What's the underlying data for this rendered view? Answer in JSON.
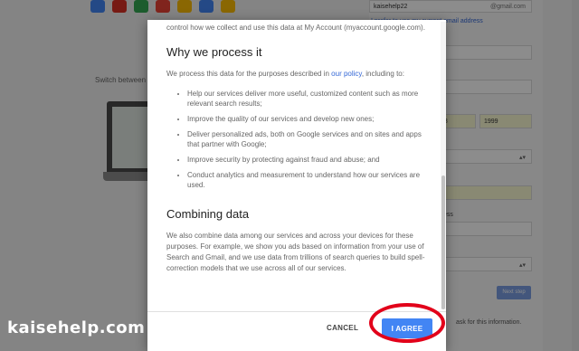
{
  "background": {
    "app_icons": [
      {
        "icon": "google-icon",
        "color": "#4285f4"
      },
      {
        "icon": "gmail-icon",
        "color": "#d93025"
      },
      {
        "icon": "maps-icon",
        "color": "#34a853"
      },
      {
        "icon": "youtube-icon",
        "color": "#ea4335"
      },
      {
        "icon": "drive-icon",
        "color": "#fbbc05"
      },
      {
        "icon": "play-icon",
        "color": "#4285f4"
      },
      {
        "icon": "chrome-icon",
        "color": "#fbbc05"
      }
    ],
    "switch_text": "Switch between",
    "form": {
      "username_value": "kaisehelp22",
      "username_domain": "@gmail.com",
      "link_text": "I prefer to use my current email address",
      "day_value": "18",
      "year_value": "1999",
      "section_label": "ess",
      "country_value": "m",
      "next_label": "Next step",
      "footer_text": "ask for this information."
    }
  },
  "watermark": "kaisehelp.com",
  "dialog": {
    "intro_text": "control how we collect and use this data at My Account (myaccount.google.com).",
    "section1_heading": "Why we process it",
    "section1_text_before": "We process this data for the purposes described in ",
    "section1_link": "our policy",
    "section1_text_after": ", including to:",
    "bullets": [
      "Help our services deliver more useful, customized content such as more relevant search results;",
      "Improve the quality of our services and develop new ones;",
      "Deliver personalized ads, both on Google services and on sites and apps that partner with Google;",
      "Improve security by protecting against fraud and abuse; and",
      "Conduct analytics and measurement to understand how our services are used."
    ],
    "section2_heading": "Combining data",
    "section2_text": "We also combine data among our services and across your devices for these purposes. For example, we show you ads based on information from your use of Search and Gmail, and we use data from trillions of search queries to build spell-correction models that we use across all of our services.",
    "cancel_label": "CANCEL",
    "agree_label": "I AGREE"
  },
  "colors": {
    "accent": "#4285f4",
    "link": "#3367d6",
    "highlight_ring": "#e2001a"
  }
}
